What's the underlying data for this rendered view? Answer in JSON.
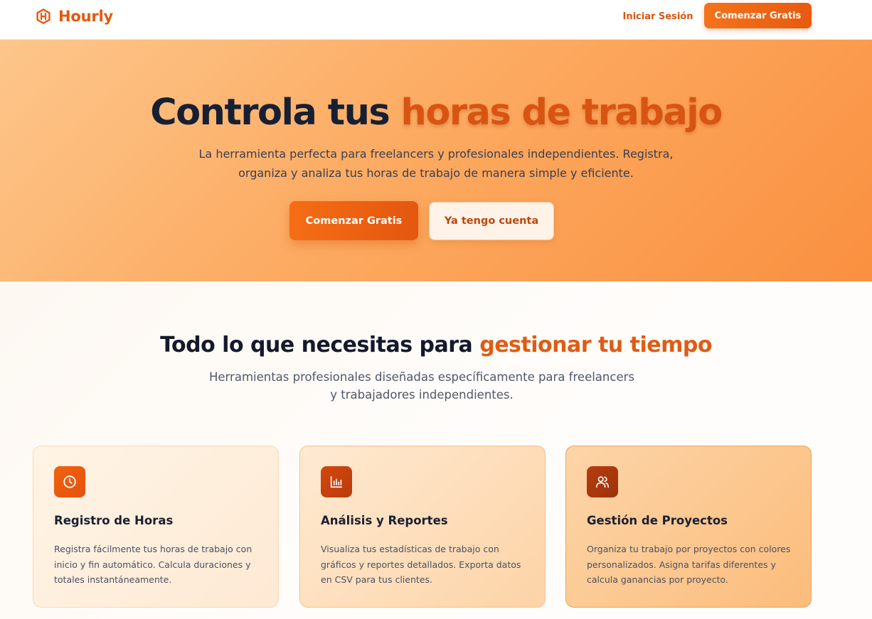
{
  "nav": {
    "brand": "Hourly",
    "logo_icon": "hexagon-h-logo-icon",
    "login": "Iniciar Sesión",
    "cta": "Comenzar Gratis"
  },
  "hero": {
    "title_plain": "Controla tus ",
    "title_accent": "horas de trabajo",
    "subtitle": "La herramienta perfecta para freelancers y profesionales independientes. Registra, organiza y analiza tus horas de trabajo de manera simple y eficiente.",
    "primary_button": "Comenzar Gratis",
    "secondary_button": "Ya tengo cuenta"
  },
  "features": {
    "title_plain": "Todo lo que necesitas para ",
    "title_accent": "gestionar tu tiempo",
    "subtitle": "Herramientas profesionales diseñadas específicamente para freelancers y trabajadores independientes.",
    "cards": [
      {
        "icon": "clock-icon",
        "title": "Registro de Horas",
        "description": "Registra fácilmente tus horas de trabajo con inicio y fin automático. Calcula duraciones y totales instantáneamente."
      },
      {
        "icon": "bar-chart-icon",
        "title": "Análisis y Reportes",
        "description": "Visualiza tus estadísticas de trabajo con gráficos y reportes detallados. Exporta datos en CSV para tus clientes."
      },
      {
        "icon": "users-icon",
        "title": "Gestión de Proyectos",
        "description": "Organiza tu trabajo por proyectos con colores personalizados. Asigna tarifas diferentes y calcula ganancias por proyecto."
      }
    ]
  },
  "colors": {
    "brand_orange": "#e4580f",
    "accent_text": "#d95412",
    "heading_dark": "#172033",
    "hero_gradient_start": "#fdc68b",
    "hero_gradient_end": "#fa9040"
  }
}
